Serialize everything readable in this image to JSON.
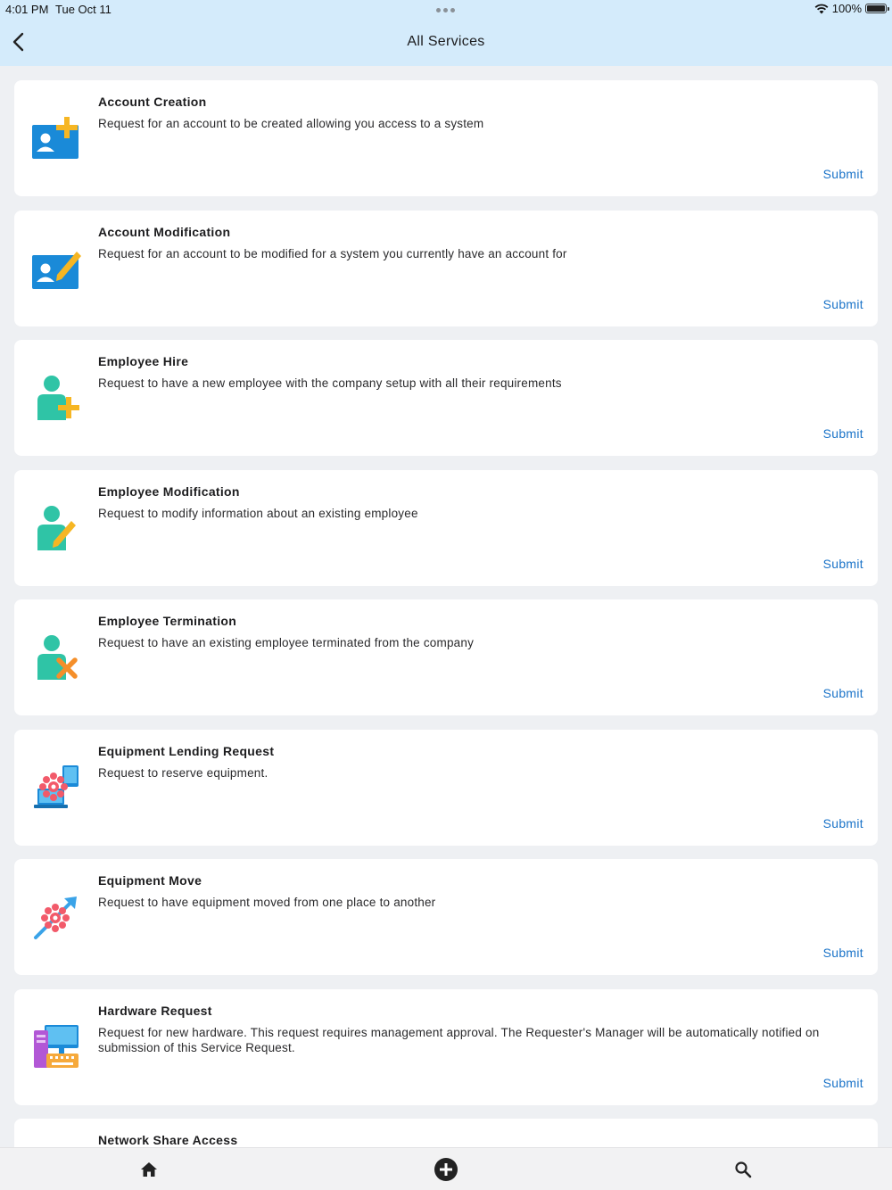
{
  "status_bar": {
    "time": "4:01 PM",
    "date": "Tue Oct 11",
    "battery": "100%"
  },
  "header": {
    "title": "All Services",
    "back_icon": "chevron-left-icon"
  },
  "services": [
    {
      "title": "Account Creation",
      "description": "Request for an account to be created allowing you access to a system",
      "action": "Submit",
      "icon": "account-add-icon"
    },
    {
      "title": "Account Modification",
      "description": "Request for an account to be modified for a system you currently have an account for",
      "action": "Submit",
      "icon": "account-edit-icon"
    },
    {
      "title": "Employee Hire",
      "description": "Request to have a new employee with the company setup with all their requirements",
      "action": "Submit",
      "icon": "person-add-icon"
    },
    {
      "title": "Employee Modification",
      "description": "Request to modify information about an existing employee",
      "action": "Submit",
      "icon": "person-edit-icon"
    },
    {
      "title": "Employee Termination",
      "description": "Request to have an existing employee terminated from the company",
      "action": "Submit",
      "icon": "person-remove-icon"
    },
    {
      "title": "Equipment Lending Request",
      "description": "Request to reserve equipment.",
      "action": "Submit",
      "icon": "equipment-lending-icon"
    },
    {
      "title": "Equipment Move",
      "description": "Request to have equipment moved from one place to another",
      "action": "Submit",
      "icon": "equipment-move-icon"
    },
    {
      "title": "Hardware Request",
      "description": "Request for new hardware. This request requires management approval. The Requester's Manager will be automatically notified on submission of this Service Request.",
      "action": "Submit",
      "icon": "hardware-icon"
    },
    {
      "title": "Network Share Access",
      "description": "",
      "action": "",
      "icon": ""
    }
  ],
  "bottom_nav": {
    "home_icon": "home-icon",
    "add_icon": "add-circle-icon",
    "search_icon": "search-icon"
  },
  "colors": {
    "header_bg": "#d4ebfb",
    "accent": "#1a73c8",
    "card_bg": "#ffffff",
    "page_bg": "#eef0f3"
  }
}
